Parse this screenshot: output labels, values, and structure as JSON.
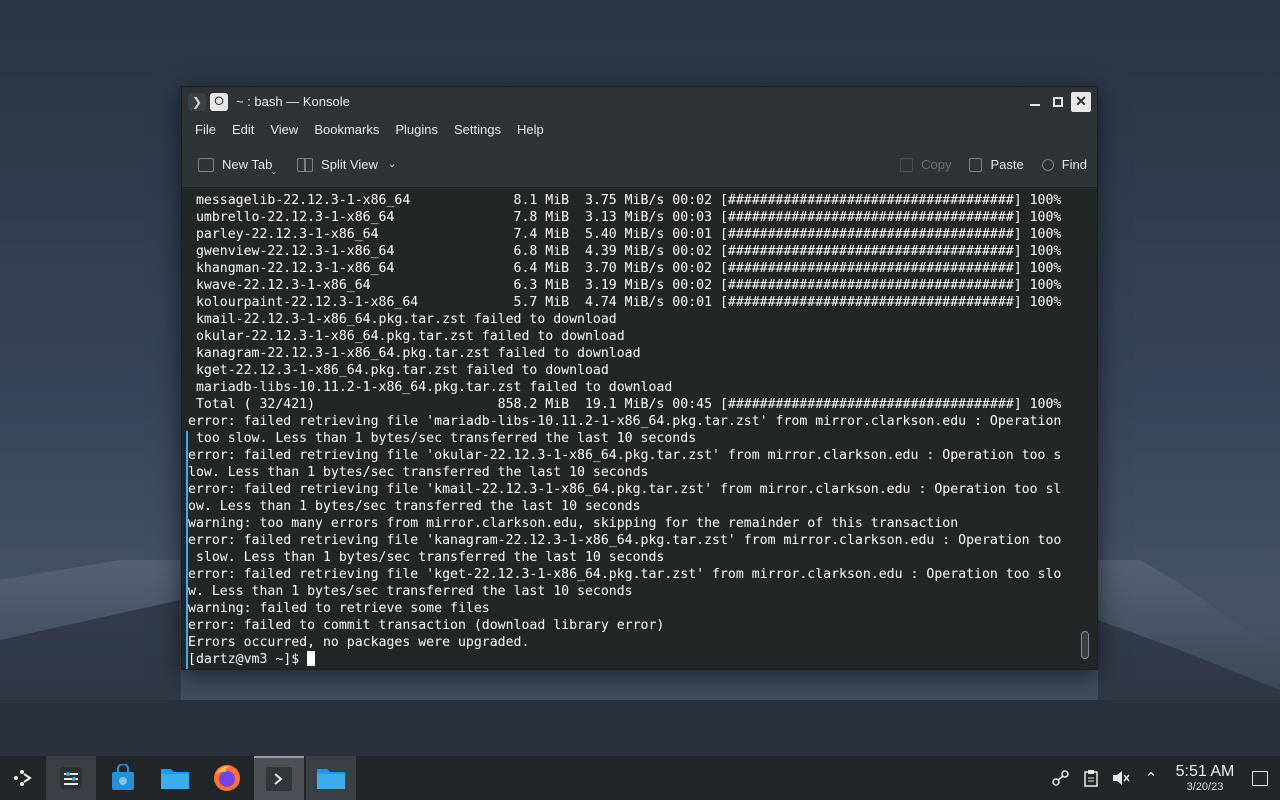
{
  "window": {
    "title": "~ : bash — Konsole"
  },
  "menu": [
    "File",
    "Edit",
    "View",
    "Bookmarks",
    "Plugins",
    "Settings",
    "Help"
  ],
  "toolbar": {
    "new_tab": "New Tab",
    "split_view": "Split View",
    "copy": "Copy",
    "paste": "Paste",
    "find": "Find"
  },
  "terminal": {
    "lines": [
      " messagelib-22.12.3-1-x86_64             8.1 MiB  3.75 MiB/s 00:02 [####################################] 100%",
      " umbrello-22.12.3-1-x86_64               7.8 MiB  3.13 MiB/s 00:03 [####################################] 100%",
      " parley-22.12.3-1-x86_64                 7.4 MiB  5.40 MiB/s 00:01 [####################################] 100%",
      " gwenview-22.12.3-1-x86_64               6.8 MiB  4.39 MiB/s 00:02 [####################################] 100%",
      " khangman-22.12.3-1-x86_64               6.4 MiB  3.70 MiB/s 00:02 [####################################] 100%",
      " kwave-22.12.3-1-x86_64                  6.3 MiB  3.19 MiB/s 00:02 [####################################] 100%",
      " kolourpaint-22.12.3-1-x86_64            5.7 MiB  4.74 MiB/s 00:01 [####################################] 100%",
      " kmail-22.12.3-1-x86_64.pkg.tar.zst failed to download",
      " okular-22.12.3-1-x86_64.pkg.tar.zst failed to download",
      " kanagram-22.12.3-1-x86_64.pkg.tar.zst failed to download",
      " kget-22.12.3-1-x86_64.pkg.tar.zst failed to download",
      " mariadb-libs-10.11.2-1-x86_64.pkg.tar.zst failed to download",
      " Total ( 32/421)                       858.2 MiB  19.1 MiB/s 00:45 [####################################] 100%",
      "error: failed retrieving file 'mariadb-libs-10.11.2-1-x86_64.pkg.tar.zst' from mirror.clarkson.edu : Operation",
      " too slow. Less than 1 bytes/sec transferred the last 10 seconds",
      "error: failed retrieving file 'okular-22.12.3-1-x86_64.pkg.tar.zst' from mirror.clarkson.edu : Operation too s",
      "low. Less than 1 bytes/sec transferred the last 10 seconds",
      "error: failed retrieving file 'kmail-22.12.3-1-x86_64.pkg.tar.zst' from mirror.clarkson.edu : Operation too sl",
      "ow. Less than 1 bytes/sec transferred the last 10 seconds",
      "warning: too many errors from mirror.clarkson.edu, skipping for the remainder of this transaction",
      "error: failed retrieving file 'kanagram-22.12.3-1-x86_64.pkg.tar.zst' from mirror.clarkson.edu : Operation too",
      " slow. Less than 1 bytes/sec transferred the last 10 seconds",
      "error: failed retrieving file 'kget-22.12.3-1-x86_64.pkg.tar.zst' from mirror.clarkson.edu : Operation too slo",
      "w. Less than 1 bytes/sec transferred the last 10 seconds",
      "warning: failed to retrieve some files",
      "error: failed to commit transaction (download library error)",
      "Errors occurred, no packages were upgraded."
    ],
    "prompt": "[dartz@vm3 ~]$ "
  },
  "taskbar": {
    "apps": [
      {
        "name": "application-launcher",
        "icon": "launcher-icon"
      },
      {
        "name": "system-settings",
        "icon": "settings-icon"
      },
      {
        "name": "discover",
        "icon": "store-icon"
      },
      {
        "name": "dolphin",
        "icon": "folder-icon"
      },
      {
        "name": "firefox",
        "icon": "firefox-icon"
      },
      {
        "name": "konsole",
        "icon": "terminal-icon"
      },
      {
        "name": "dolphin-window",
        "icon": "folder-icon"
      }
    ],
    "time": "5:51 AM",
    "date": "3/20/23"
  },
  "colors": {
    "terminal_bg": "#232627",
    "terminal_fg": "#fcfcfc",
    "accent": "#3daee9",
    "taskbar_bg": "#232629"
  }
}
